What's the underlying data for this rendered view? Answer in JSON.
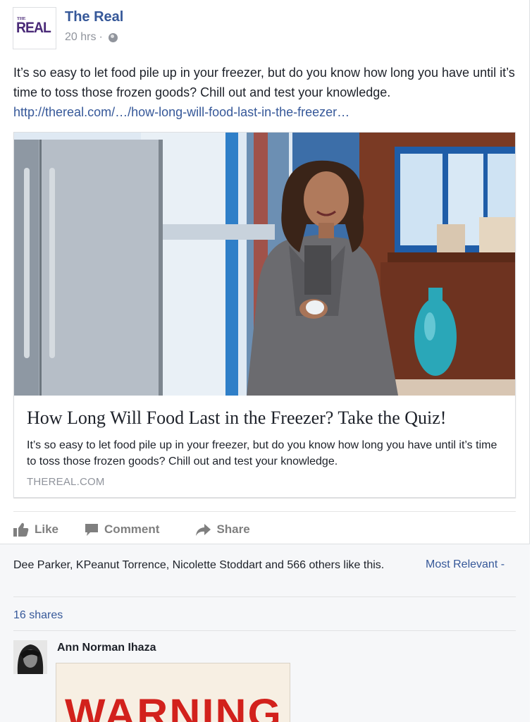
{
  "post": {
    "page_name": "The Real",
    "avatar_logo": {
      "small": "THE",
      "text": "REAL"
    },
    "time": "20 hrs",
    "separator": "·",
    "privacy_icon": "globe-icon",
    "text": "It’s so easy to let food pile up in your freezer, but do you know how long you have until it’s time to toss those frozen goods? Chill out and test your knowledge. ",
    "link_text": "http://thereal.com/…/how-long-will-food-last-in-the-freezer…"
  },
  "preview": {
    "title": "How Long Will Food Last in the Freezer? Take the Quiz!",
    "description": "It’s so easy to let food pile up in your freezer, but do you know how long you have until it’s time to toss those frozen goods? Chill out and test your knowledge.",
    "domain": "THEREAL.COM"
  },
  "actions": {
    "like": "Like",
    "comment": "Comment",
    "share": "Share",
    "icons": [
      "like-icon",
      "comment-icon",
      "share-icon"
    ]
  },
  "reactions": {
    "likes_text": "Dee Parker, KPeanut Torrence, Nicolette Stoddart and 566 others like this.",
    "sort_label": "Most Relevant -",
    "shares": "16 shares"
  },
  "comment": {
    "author": "Ann Norman Ihaza",
    "image_text": "WARNING"
  },
  "colors": {
    "link": "#365899",
    "muted": "#90949c",
    "text": "#1d2129",
    "footer_bg": "#f6f7f9",
    "warning_red": "#d2211c"
  }
}
